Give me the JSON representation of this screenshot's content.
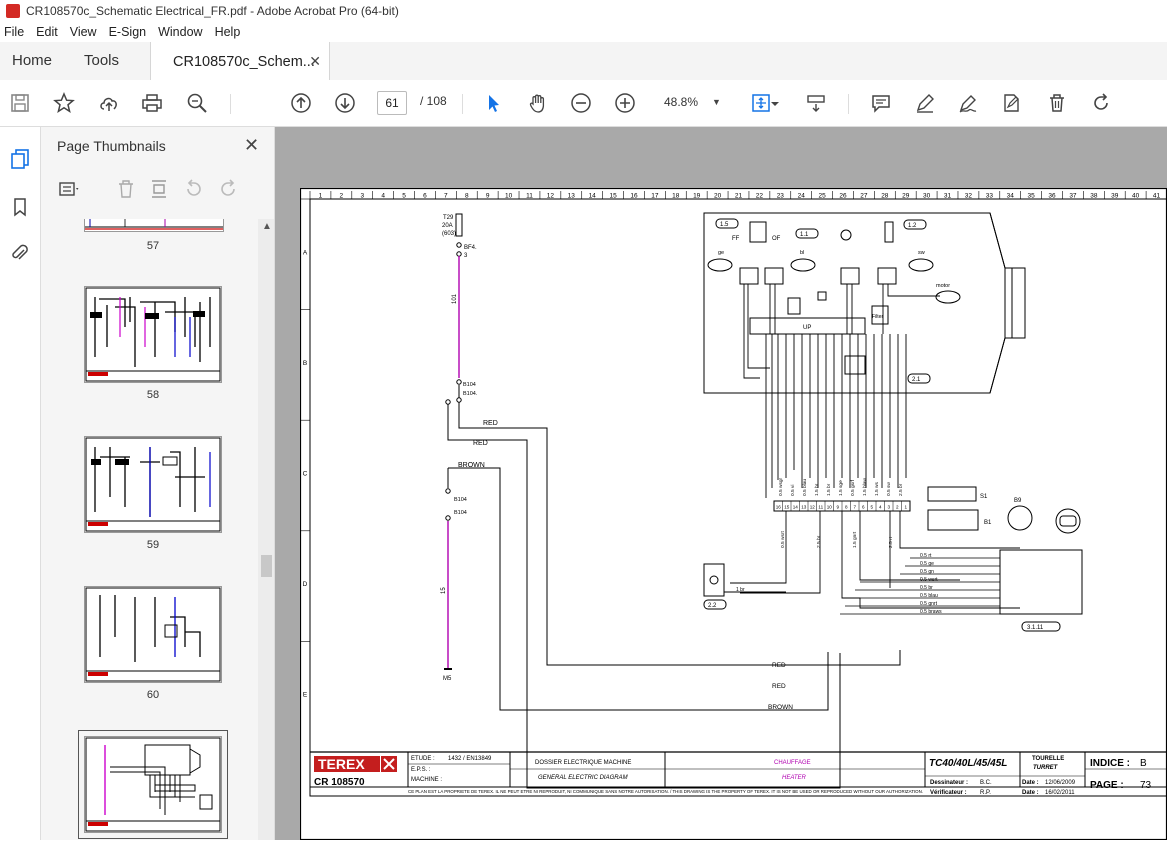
{
  "window": {
    "title": "CR108570c_Schematic Electrical_FR.pdf - Adobe Acrobat Pro (64-bit)"
  },
  "menu": [
    "File",
    "Edit",
    "View",
    "E-Sign",
    "Window",
    "Help"
  ],
  "tabs": {
    "home": "Home",
    "tools": "Tools",
    "document": "CR108570c_Schem...",
    "close": "✕"
  },
  "toolbar": {
    "page_current": "61",
    "page_total": "/ 108",
    "zoom": "48.8%"
  },
  "icons": {
    "save": "save-icon",
    "bookmark": "star-icon",
    "upload": "cloud-upload-icon",
    "print": "printer-icon",
    "search": "search-zoom-icon",
    "prev": "arrow-up-circle-icon",
    "next": "arrow-down-circle-icon",
    "select": "cursor-arrow-icon",
    "hand": "hand-icon",
    "zoom_out": "minus-circle-icon",
    "zoom_in": "plus-circle-icon",
    "fit": "fit-page-icon",
    "scroll": "scroll-mode-icon",
    "comment": "comment-icon",
    "highlight": "pen-icon",
    "sign": "sign-icon",
    "fill": "fill-sign-icon",
    "delete": "trash-icon",
    "rotate": "rotate-icon"
  },
  "accent": "#1473e6",
  "thumbnails_panel": {
    "title": "Page Thumbnails",
    "close": "✕",
    "pages": [
      "57",
      "58",
      "59",
      "60"
    ]
  },
  "schematic": {
    "columns": [
      "1",
      "2",
      "3",
      "4",
      "5",
      "6",
      "7",
      "8",
      "9",
      "10",
      "11",
      "12",
      "13",
      "14",
      "15",
      "16",
      "17",
      "18",
      "19",
      "20",
      "21",
      "22",
      "23",
      "24",
      "25",
      "26",
      "27",
      "28",
      "29",
      "30",
      "31",
      "32",
      "33",
      "34",
      "35",
      "36",
      "37",
      "38",
      "39",
      "40",
      "41"
    ],
    "rows": [
      "A",
      "B",
      "C",
      "D",
      "E"
    ],
    "fuse": {
      "t": "T29",
      "a": "20A",
      "code": "(603)",
      "bf": "BF4.",
      "n3": "3"
    },
    "wires": {
      "w101": "101",
      "w15": "15",
      "red1": "RED",
      "red2": "RED",
      "brown": "BROWN",
      "red3": "RED",
      "red4": "RED",
      "brown2": "BROWN"
    },
    "conn": {
      "b104a": "B104",
      "b104b": "B104.",
      "b104c": "B104",
      "b104d": "B104",
      "m5": "M5"
    },
    "refs": {
      "r15": "1.5",
      "r11": "1.1",
      "r12": "1.2",
      "r21": "2.1",
      "r22": "2.2",
      "r3111": "3.1.11"
    },
    "labels": {
      "ff": "FF",
      "of": "OF",
      "ge": "ge",
      "bl": "bl",
      "sw": "sw",
      "motor": "motor",
      "up": "UP",
      "filter": "Filter",
      "s1": "S1",
      "b1": "B1",
      "b9": "B9",
      "onebr": "1 br"
    },
    "strip_top": [
      "0.5 wsgr",
      "0.5 vi",
      "0.5 blau",
      "1.5 br",
      "1.5 br",
      "1.5 sge",
      "0.5 gsrf",
      "1.5 blaw",
      "1.5 ws",
      "0.5 sw",
      "2.5 br"
    ],
    "strip_nums": [
      "16",
      "15",
      "14",
      "13",
      "12",
      "11",
      "10",
      "9",
      "8",
      "7",
      "6",
      "5",
      "4",
      "3",
      "2",
      "1"
    ],
    "strip_bottom": [
      "0.5 wsrt",
      "2.5 br",
      "1.5 gnrt",
      "2.5 rt"
    ],
    "right_wires": [
      "0.5 rt",
      "0.5 ge",
      "0.5 gn",
      "0.5 wsrt",
      "0.5 br",
      "0.5 blau",
      "0.5 gnrt",
      "0.5 braws"
    ],
    "title_block": {
      "brand": "TEREX",
      "code": "CR 108570",
      "etude_lbl": "ETUDE :",
      "etude_val": "1432 / EN13849",
      "eps_lbl": "E.P.S. :",
      "machine_lbl": "MACHINE :",
      "dossier_fr": "DOSSIER ELECTRIQUE MACHINE",
      "dossier_en": "GENERAL ELECTRIC DIAGRAM",
      "sub_fr": "CHAUFFAGE",
      "sub_en": "HEATER",
      "model": "TC40/40L/45/45L",
      "turret_fr": "TOURELLE",
      "turret_en": "TURRET",
      "dessinateur_lbl": "Dessinateur :",
      "dessinateur_val": "B.C.",
      "verif_lbl": "Vérificateur :",
      "verif_val": "R.P.",
      "date_lbl": "Date :",
      "date1": "12/06/2009",
      "date2": "16/02/2011",
      "indice_lbl": "INDICE :",
      "indice_val": "B",
      "page_lbl": "PAGE :",
      "page_val": "73",
      "legal": "CE PLAN EST LA PROPRIETE DE TEREX. IL NE PEUT ETRE NI REPRODUIT, NI COMMUNIQUE SANS NOTRE AUTORISATION. / THIS DRAWING IS THE PROPERTY OF TEREX. IT IS NOT BE USED OR REPRODUCED WITHOUT OUR AUTHORIZATION."
    }
  }
}
